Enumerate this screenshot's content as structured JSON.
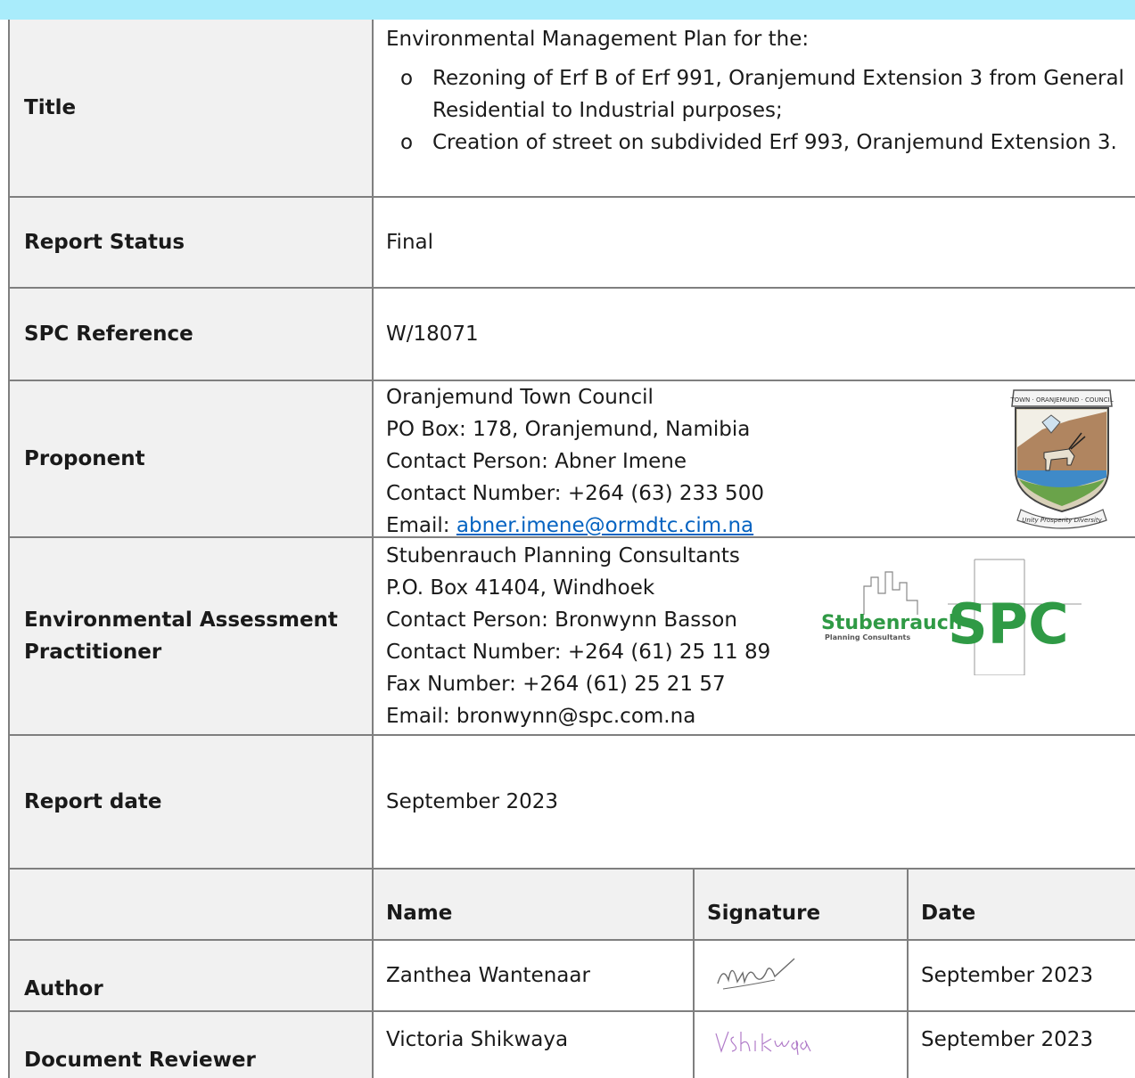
{
  "rows": {
    "title": {
      "label": "Title",
      "intro": "Environmental Management Plan for the:",
      "bullets": [
        {
          "marker": "o",
          "lines": [
            "Rezoning of Erf B of Erf 991, Oranjemund Extension 3 from General",
            "Residential to Industrial purposes;"
          ]
        },
        {
          "marker": "o",
          "lines": [
            "Creation of street on subdivided Erf 993, Oranjemund Extension 3."
          ]
        }
      ]
    },
    "status": {
      "label": "Report Status",
      "value": "Final"
    },
    "reference": {
      "label": "SPC Reference",
      "value": "W/18071"
    },
    "proponent": {
      "label": "Proponent",
      "lines": [
        "Oranjemund Town Council",
        "PO Box: 178, Oranjemund, Namibia",
        "Contact Person: Abner Imene",
        "Contact Number: +264 (63) 233 500"
      ],
      "email_prefix": "Email: ",
      "email": "abner.imene@ormdtc.cim.na",
      "crest_text": "TOWN · ORANJEMUND · COUNCIL",
      "crest_motto": "Unity Prosperity Diversity"
    },
    "practitioner": {
      "label_line1": "Environmental Assessment",
      "label_line2": "Practitioner",
      "lines": [
        "Stubenrauch Planning Consultants",
        "P.O. Box 41404, Windhoek",
        "Contact Person: Bronwynn Basson",
        "Contact Number: +264 (61) 25 11 89",
        "Fax Number: +264 (61) 25 21 57",
        "Email: bronwynn@spc.com.na"
      ],
      "logo_name": "Stubenrauch",
      "logo_sub": "Planning Consultants",
      "logo_mark": "SPC"
    },
    "date": {
      "label": "Report date",
      "value": "September 2023"
    },
    "signoff_header": {
      "name": "Name",
      "signature": "Signature",
      "date": "Date"
    },
    "author": {
      "label": "Author",
      "name": "Zanthea Wantenaar",
      "signature": "ZWart",
      "date": "September 2023"
    },
    "reviewer": {
      "label": "Document Reviewer",
      "name": "Victoria Shikwaya",
      "signature": "VShikwaya",
      "date": "September 2023"
    }
  },
  "colors": {
    "header_bar": "#a9ecfb",
    "label_bg": "#f1f1f1",
    "border": "#7f7f7f",
    "link": "#0563c1",
    "logo_green": "#2f9a45"
  }
}
